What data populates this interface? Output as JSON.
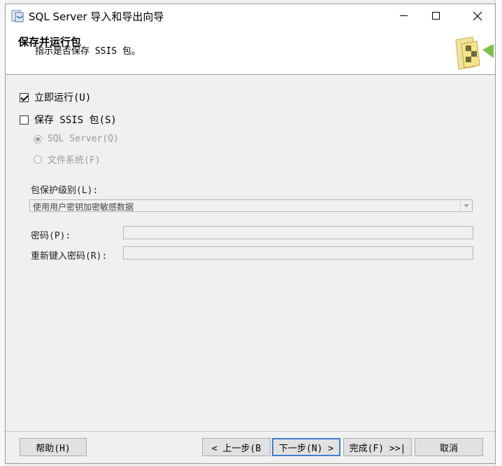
{
  "window": {
    "title": "SQL Server 导入和导出向导"
  },
  "header": {
    "title": "保存并运行包",
    "description": "指示是否保存 SSIS 包。"
  },
  "options": {
    "run_immediately": {
      "label": "立即运行(U)",
      "checked": true
    },
    "save_ssis": {
      "label": "保存 SSIS 包(S)",
      "checked": false
    },
    "radio_sql_server": {
      "label": "SQL Server(Q)",
      "selected": true,
      "enabled": false
    },
    "radio_file_system": {
      "label": "文件系统(F)",
      "selected": false,
      "enabled": false
    }
  },
  "protection": {
    "label": "包保护级别(L):",
    "selected": "使用用户密钥加密敏感数据"
  },
  "password": {
    "label": "密码(P):",
    "value": ""
  },
  "retype_password": {
    "label": "重新键入密码(R):",
    "value": ""
  },
  "buttons": {
    "help": "帮助(H)",
    "back": "< 上一步(B",
    "next": "下一步(N) >",
    "finish": "完成(F) >>|",
    "cancel": "取消"
  }
}
